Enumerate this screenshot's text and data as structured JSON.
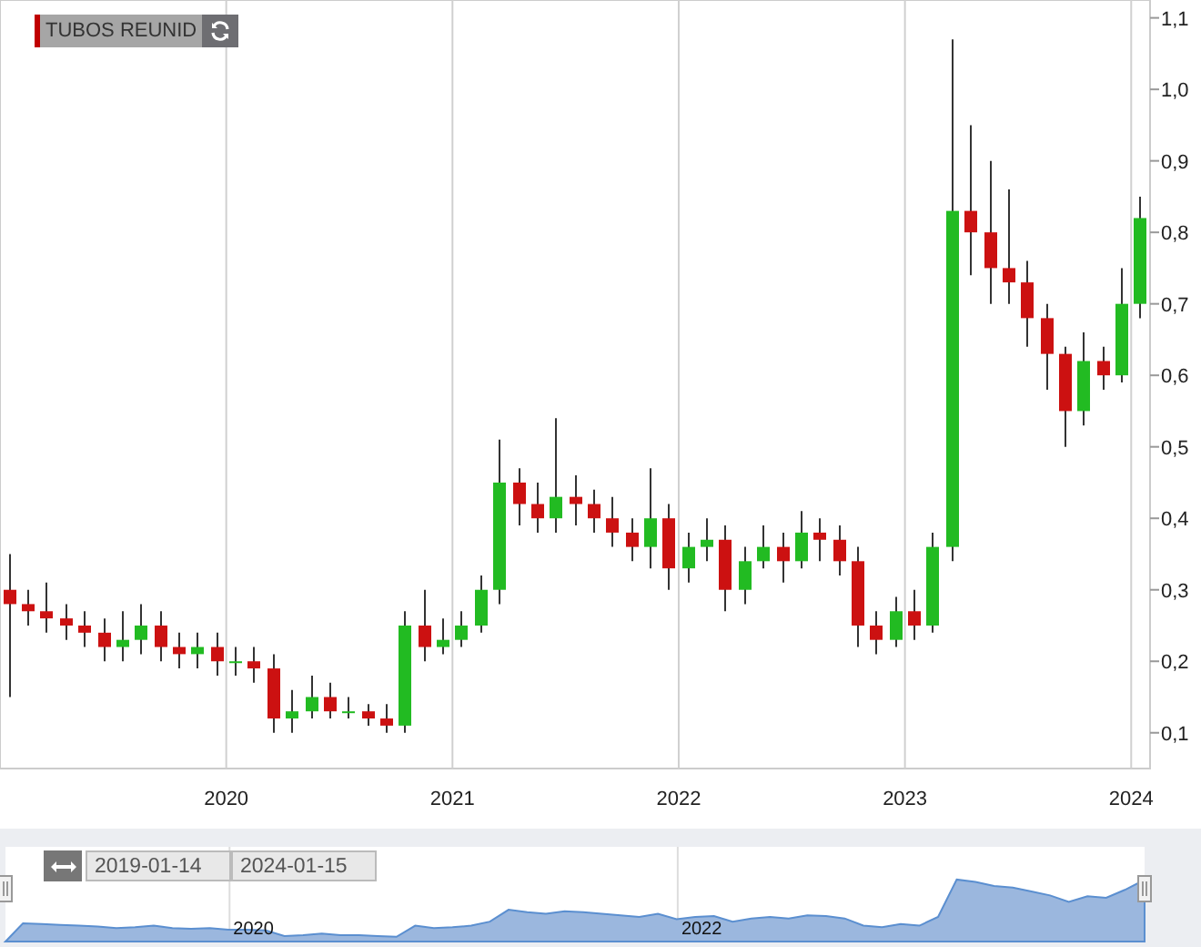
{
  "legend": {
    "label": "TUBOS REUNID",
    "color": "#c00000"
  },
  "chart": {
    "chart_data": {
      "type": "candlestick",
      "grid": true,
      "xlim": [
        "2019-01-01",
        "2024-02-01"
      ],
      "ylim": [
        0.05,
        1.125
      ],
      "x": [
        "2019-01-15",
        "2019-02-15",
        "2019-03-15",
        "2019-04-15",
        "2019-05-15",
        "2019-06-15",
        "2019-07-15",
        "2019-08-15",
        "2019-09-15",
        "2019-10-15",
        "2019-11-15",
        "2019-12-15",
        "2020-01-15",
        "2020-02-15",
        "2020-03-15",
        "2020-04-15",
        "2020-05-15",
        "2020-06-15",
        "2020-07-15",
        "2020-08-15",
        "2020-09-15",
        "2020-10-15",
        "2020-11-15",
        "2020-12-15",
        "2021-01-15",
        "2021-02-15",
        "2021-03-15",
        "2021-04-15",
        "2021-05-15",
        "2021-06-15",
        "2021-07-15",
        "2021-08-15",
        "2021-09-15",
        "2021-10-15",
        "2021-11-15",
        "2021-12-15",
        "2022-01-15",
        "2022-02-15",
        "2022-03-15",
        "2022-04-15",
        "2022-05-15",
        "2022-06-15",
        "2022-07-15",
        "2022-08-15",
        "2022-09-15",
        "2022-10-15",
        "2022-11-15",
        "2022-12-15",
        "2023-01-15",
        "2023-02-15",
        "2023-03-15",
        "2023-04-15",
        "2023-05-15",
        "2023-06-15",
        "2023-07-15",
        "2023-08-15",
        "2023-09-15",
        "2023-10-15",
        "2023-11-15",
        "2023-12-15",
        "2024-01-15"
      ],
      "ohlc": [
        [
          0.3,
          0.35,
          0.15,
          0.28
        ],
        [
          0.28,
          0.3,
          0.25,
          0.27
        ],
        [
          0.27,
          0.31,
          0.24,
          0.26
        ],
        [
          0.26,
          0.28,
          0.23,
          0.25
        ],
        [
          0.25,
          0.27,
          0.22,
          0.24
        ],
        [
          0.24,
          0.26,
          0.2,
          0.22
        ],
        [
          0.22,
          0.27,
          0.2,
          0.23
        ],
        [
          0.23,
          0.28,
          0.21,
          0.25
        ],
        [
          0.25,
          0.27,
          0.2,
          0.22
        ],
        [
          0.22,
          0.24,
          0.19,
          0.21
        ],
        [
          0.21,
          0.24,
          0.19,
          0.22
        ],
        [
          0.22,
          0.24,
          0.18,
          0.2
        ],
        [
          0.2,
          0.22,
          0.18,
          0.2
        ],
        [
          0.2,
          0.22,
          0.17,
          0.19
        ],
        [
          0.19,
          0.21,
          0.1,
          0.12
        ],
        [
          0.12,
          0.16,
          0.1,
          0.13
        ],
        [
          0.13,
          0.18,
          0.12,
          0.15
        ],
        [
          0.15,
          0.17,
          0.12,
          0.13
        ],
        [
          0.13,
          0.15,
          0.12,
          0.13
        ],
        [
          0.13,
          0.14,
          0.11,
          0.12
        ],
        [
          0.12,
          0.14,
          0.1,
          0.11
        ],
        [
          0.11,
          0.27,
          0.1,
          0.25
        ],
        [
          0.25,
          0.3,
          0.2,
          0.22
        ],
        [
          0.22,
          0.26,
          0.21,
          0.23
        ],
        [
          0.23,
          0.27,
          0.22,
          0.25
        ],
        [
          0.25,
          0.32,
          0.24,
          0.3
        ],
        [
          0.3,
          0.51,
          0.28,
          0.45
        ],
        [
          0.45,
          0.47,
          0.39,
          0.42
        ],
        [
          0.42,
          0.45,
          0.38,
          0.4
        ],
        [
          0.4,
          0.54,
          0.38,
          0.43
        ],
        [
          0.43,
          0.46,
          0.39,
          0.42
        ],
        [
          0.42,
          0.44,
          0.38,
          0.4
        ],
        [
          0.4,
          0.43,
          0.36,
          0.38
        ],
        [
          0.38,
          0.4,
          0.34,
          0.36
        ],
        [
          0.36,
          0.47,
          0.33,
          0.4
        ],
        [
          0.4,
          0.42,
          0.3,
          0.33
        ],
        [
          0.33,
          0.38,
          0.31,
          0.36
        ],
        [
          0.36,
          0.4,
          0.34,
          0.37
        ],
        [
          0.37,
          0.39,
          0.27,
          0.3
        ],
        [
          0.3,
          0.36,
          0.28,
          0.34
        ],
        [
          0.34,
          0.39,
          0.33,
          0.36
        ],
        [
          0.36,
          0.38,
          0.31,
          0.34
        ],
        [
          0.34,
          0.41,
          0.33,
          0.38
        ],
        [
          0.38,
          0.4,
          0.34,
          0.37
        ],
        [
          0.37,
          0.39,
          0.32,
          0.34
        ],
        [
          0.34,
          0.36,
          0.22,
          0.25
        ],
        [
          0.25,
          0.27,
          0.21,
          0.23
        ],
        [
          0.23,
          0.29,
          0.22,
          0.27
        ],
        [
          0.27,
          0.3,
          0.23,
          0.25
        ],
        [
          0.25,
          0.38,
          0.24,
          0.36
        ],
        [
          0.36,
          1.07,
          0.34,
          0.83
        ],
        [
          0.83,
          0.95,
          0.74,
          0.8
        ],
        [
          0.8,
          0.9,
          0.7,
          0.75
        ],
        [
          0.75,
          0.86,
          0.7,
          0.73
        ],
        [
          0.73,
          0.76,
          0.64,
          0.68
        ],
        [
          0.68,
          0.7,
          0.58,
          0.63
        ],
        [
          0.63,
          0.64,
          0.5,
          0.55
        ],
        [
          0.55,
          0.66,
          0.53,
          0.62
        ],
        [
          0.62,
          0.64,
          0.58,
          0.6
        ],
        [
          0.6,
          0.75,
          0.59,
          0.7
        ],
        [
          0.7,
          0.85,
          0.68,
          0.82
        ]
      ],
      "yticks": [
        {
          "value": 1.1,
          "label": "1,1"
        },
        {
          "value": 1.0,
          "label": "1,0"
        },
        {
          "value": 0.9,
          "label": "0,9"
        },
        {
          "value": 0.8,
          "label": "0,8"
        },
        {
          "value": 0.7,
          "label": "0,7"
        },
        {
          "value": 0.6,
          "label": "0,6"
        },
        {
          "value": 0.5,
          "label": "0,5"
        },
        {
          "value": 0.4,
          "label": "0,4"
        },
        {
          "value": 0.3,
          "label": "0,3"
        },
        {
          "value": 0.2,
          "label": "0,2"
        },
        {
          "value": 0.1,
          "label": "0,1"
        }
      ],
      "xticks": [
        {
          "value": "2020-01-01",
          "label": "2020"
        },
        {
          "value": "2021-01-01",
          "label": "2021"
        },
        {
          "value": "2022-01-01",
          "label": "2022"
        },
        {
          "value": "2023-01-01",
          "label": "2023"
        },
        {
          "value": "2024-01-01",
          "label": "2024"
        }
      ]
    }
  },
  "navigator": {
    "from": "2019-01-14",
    "to": "2024-01-15",
    "labels": [
      "2020",
      "2022"
    ]
  }
}
